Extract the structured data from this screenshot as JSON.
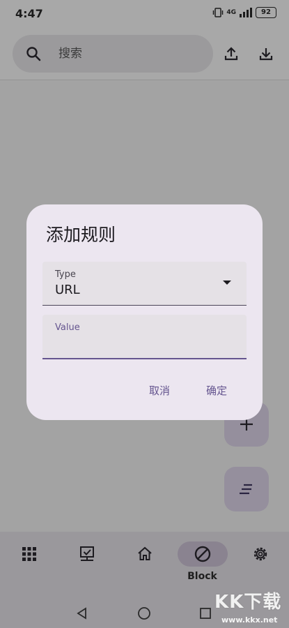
{
  "status_bar": {
    "time": "4:47",
    "network": "4G",
    "battery": "92"
  },
  "search": {
    "placeholder": "搜索"
  },
  "dialog": {
    "title": "添加规则",
    "type_field": {
      "label": "Type",
      "value": "URL"
    },
    "value_field": {
      "label": "Value",
      "value": ""
    },
    "cancel_label": "取消",
    "confirm_label": "确定"
  },
  "bottom_nav": {
    "items": [
      {
        "icon": "apps-grid-icon"
      },
      {
        "icon": "monitor-check-icon"
      },
      {
        "icon": "home-icon"
      },
      {
        "icon": "block-icon",
        "label": "Block",
        "active": true
      },
      {
        "icon": "gear-icon"
      }
    ]
  },
  "watermark": {
    "big": "KK下载",
    "small": "www.kkx.net"
  },
  "colors": {
    "dialog_bg": "#ece6f0",
    "accent": "#65558f",
    "scrim": "#a3a3a3"
  }
}
